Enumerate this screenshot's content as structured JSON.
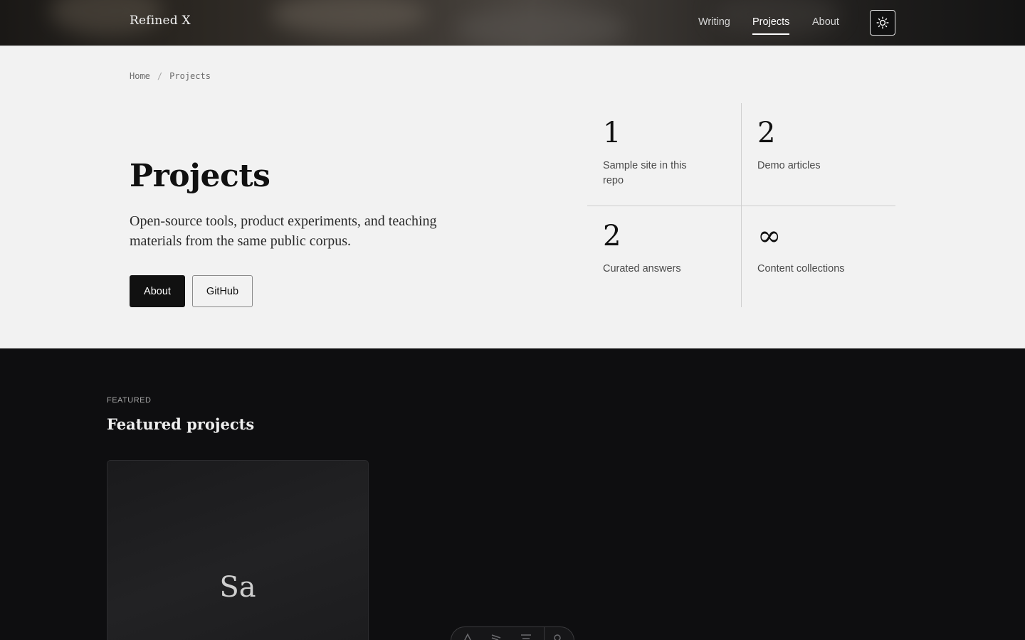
{
  "header": {
    "brand": "Refined X",
    "nav": [
      {
        "label": "Writing",
        "active": false
      },
      {
        "label": "Projects",
        "active": true
      },
      {
        "label": "About",
        "active": false
      }
    ],
    "theme_icon": "sun-icon"
  },
  "breadcrumb": {
    "items": [
      "Home",
      "Projects"
    ],
    "separator": "/"
  },
  "hero": {
    "title": "Projects",
    "lede": "Open-source tools, product experiments, and teaching materials from the same public corpus.",
    "primary_label": "About",
    "secondary_label": "GitHub"
  },
  "stats": [
    {
      "value": "1",
      "label": "Sample site in this repo"
    },
    {
      "value": "2",
      "label": "Demo articles"
    },
    {
      "value": "2",
      "label": "Curated answers"
    },
    {
      "value": "∞",
      "label": "Content collections"
    }
  ],
  "featured": {
    "kicker": "FEATURED",
    "title": "Featured projects",
    "cards": [
      {
        "initials": "Sa"
      }
    ]
  },
  "dock": {
    "icons": [
      "pen-icon",
      "brush-icon",
      "menu-icon",
      "gear-icon"
    ]
  },
  "colors": {
    "primary": "#111111",
    "dark_bg": "#0e0e10",
    "light_bg": "#f2f2f2"
  }
}
